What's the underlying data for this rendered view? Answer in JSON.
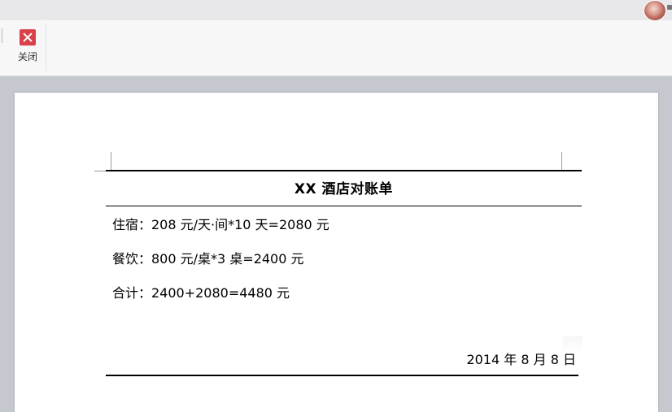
{
  "toolbar": {
    "close_label": "关闭"
  },
  "colors": {
    "close_icon_bg": "#d9414a",
    "workspace_bg": "#c6c8d0",
    "page_bg": "#ffffff"
  },
  "document": {
    "title": "XX 酒店对账单",
    "lines": [
      "住宿：208 元/天·间*10 天=2080 元",
      "餐饮：800 元/桌*3 桌=2400 元",
      "合计：2400+2080=4480 元"
    ],
    "date": "2014 年 8 月 8 日"
  }
}
